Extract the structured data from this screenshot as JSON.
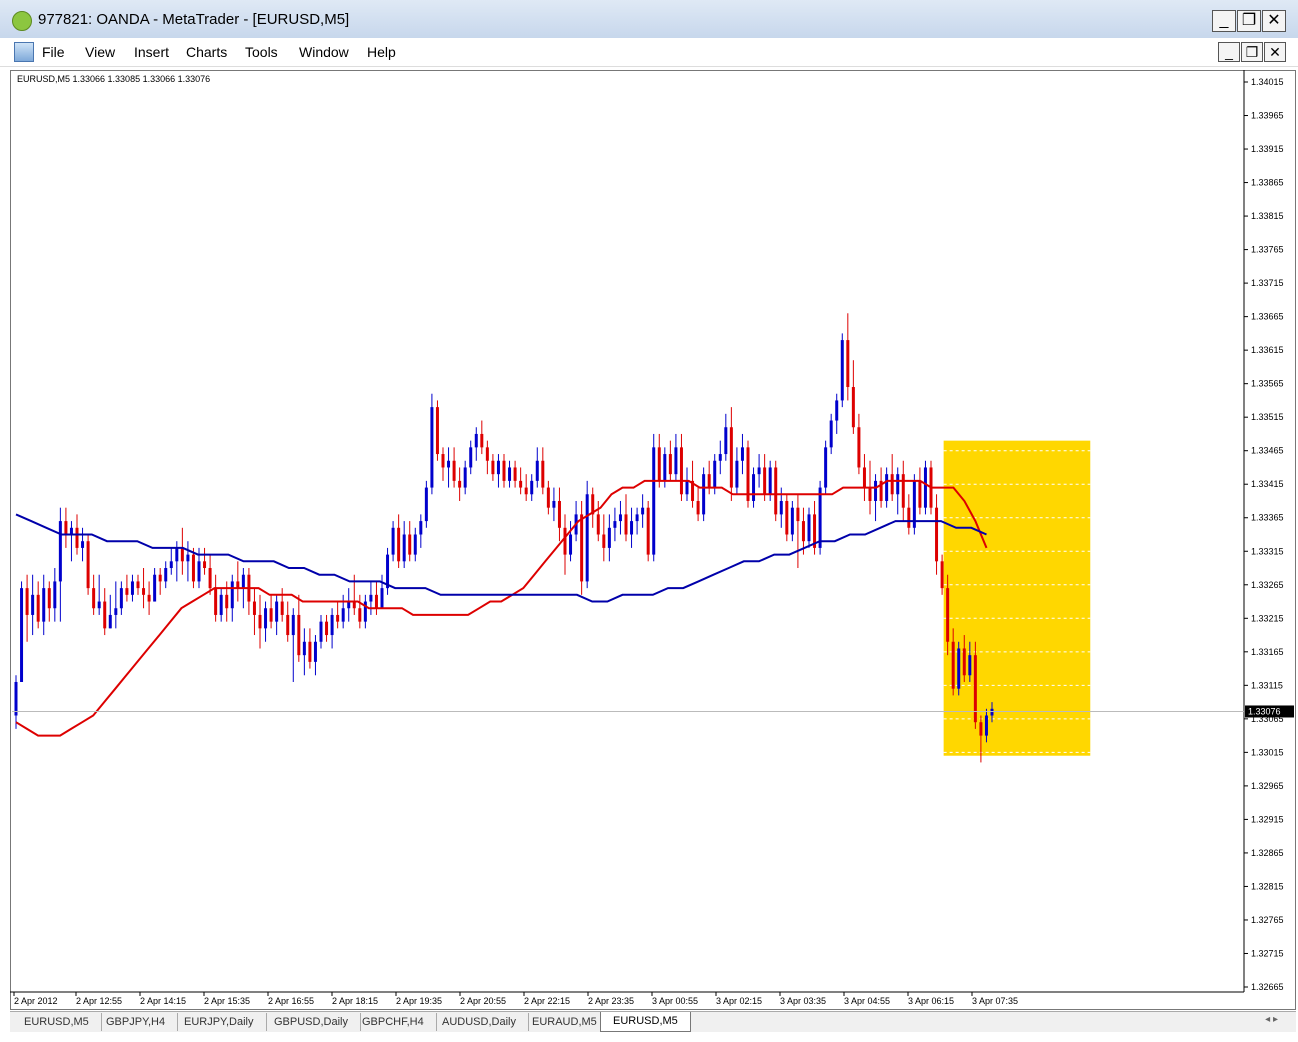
{
  "window": {
    "title": "977821: OANDA - MetaTrader - [EURUSD,M5]",
    "minimize": "_",
    "restore": "❐",
    "close": "✕"
  },
  "menu": {
    "items": [
      "File",
      "View",
      "Insert",
      "Charts",
      "Tools",
      "Window",
      "Help"
    ]
  },
  "chart": {
    "info": "EURUSD,M5  1.33066 1.33085 1.33066 1.33076",
    "current_price": "1.33076",
    "y_ticks": [
      "1.34015",
      "1.33965",
      "1.33915",
      "1.33865",
      "1.33815",
      "1.33765",
      "1.33715",
      "1.33665",
      "1.33615",
      "1.33565",
      "1.33515",
      "1.33465",
      "1.33415",
      "1.33365",
      "1.33315",
      "1.33265",
      "1.33215",
      "1.33165",
      "1.33115",
      "1.33065",
      "1.33015",
      "1.32965",
      "1.32915",
      "1.32865",
      "1.32815",
      "1.32765",
      "1.32715",
      "1.32665"
    ],
    "x_ticks": [
      "2 Apr 2012",
      "2 Apr 12:55",
      "2 Apr 14:15",
      "2 Apr 15:35",
      "2 Apr 16:55",
      "2 Apr 18:15",
      "2 Apr 19:35",
      "2 Apr 20:55",
      "2 Apr 22:15",
      "2 Apr 23:35",
      "3 Apr 00:55",
      "3 Apr 02:15",
      "3 Apr 03:35",
      "3 Apr 04:55",
      "3 Apr 06:15",
      "3 Apr 07:35"
    ],
    "colors": {
      "bull": "#0000cc",
      "bear": "#dd0000",
      "ma_fast": "#dd0000",
      "ma_slow": "#0000aa",
      "highlight": "#ffd700"
    }
  },
  "chart_data": {
    "type": "candlestick",
    "symbol": "EURUSD",
    "timeframe": "M5",
    "ylim": [
      1.32665,
      1.34015
    ],
    "highlight_range": {
      "start_index": 168,
      "end_index": 193,
      "low": 1.3301,
      "high": 1.3348
    },
    "candles": [
      [
        1.3307,
        1.3313,
        1.3305,
        1.3312
      ],
      [
        1.3312,
        1.3327,
        1.3312,
        1.3326
      ],
      [
        1.3326,
        1.3328,
        1.3318,
        1.3322
      ],
      [
        1.3322,
        1.3328,
        1.3319,
        1.3325
      ],
      [
        1.3325,
        1.3327,
        1.332,
        1.3321
      ],
      [
        1.3321,
        1.3328,
        1.3319,
        1.3326
      ],
      [
        1.3326,
        1.3327,
        1.3321,
        1.3323
      ],
      [
        1.3323,
        1.3329,
        1.3321,
        1.3327
      ],
      [
        1.3327,
        1.3338,
        1.3321,
        1.3336
      ],
      [
        1.3336,
        1.3338,
        1.3332,
        1.3334
      ],
      [
        1.3334,
        1.3336,
        1.333,
        1.3335
      ],
      [
        1.3335,
        1.3337,
        1.3331,
        1.3332
      ],
      [
        1.3332,
        1.3335,
        1.333,
        1.3333
      ],
      [
        1.3333,
        1.3334,
        1.3325,
        1.3326
      ],
      [
        1.3326,
        1.3328,
        1.3322,
        1.3323
      ],
      [
        1.3323,
        1.3328,
        1.3322,
        1.3324
      ],
      [
        1.3324,
        1.3326,
        1.3319,
        1.332
      ],
      [
        1.332,
        1.3325,
        1.332,
        1.3322
      ],
      [
        1.3322,
        1.3327,
        1.332,
        1.3323
      ],
      [
        1.3323,
        1.3327,
        1.3322,
        1.3326
      ],
      [
        1.3326,
        1.3328,
        1.3324,
        1.3325
      ],
      [
        1.3325,
        1.3328,
        1.3324,
        1.3327
      ],
      [
        1.3327,
        1.3328,
        1.3325,
        1.3326
      ],
      [
        1.3326,
        1.3329,
        1.3323,
        1.3325
      ],
      [
        1.3325,
        1.3327,
        1.3322,
        1.3324
      ],
      [
        1.3324,
        1.3329,
        1.3324,
        1.3328
      ],
      [
        1.3328,
        1.3329,
        1.3325,
        1.3327
      ],
      [
        1.3327,
        1.333,
        1.3326,
        1.3329
      ],
      [
        1.3329,
        1.3332,
        1.3328,
        1.333
      ],
      [
        1.333,
        1.3333,
        1.3327,
        1.3332
      ],
      [
        1.3332,
        1.3335,
        1.3328,
        1.333
      ],
      [
        1.333,
        1.3333,
        1.3327,
        1.3331
      ],
      [
        1.3331,
        1.3332,
        1.3326,
        1.3327
      ],
      [
        1.3327,
        1.3332,
        1.3326,
        1.333
      ],
      [
        1.333,
        1.3332,
        1.3328,
        1.3329
      ],
      [
        1.3329,
        1.3331,
        1.3325,
        1.3326
      ],
      [
        1.3326,
        1.3328,
        1.3321,
        1.3322
      ],
      [
        1.3322,
        1.3326,
        1.3321,
        1.3325
      ],
      [
        1.3325,
        1.3327,
        1.3321,
        1.3323
      ],
      [
        1.3323,
        1.3328,
        1.3321,
        1.3327
      ],
      [
        1.3327,
        1.333,
        1.3324,
        1.3326
      ],
      [
        1.3326,
        1.3329,
        1.3323,
        1.3328
      ],
      [
        1.3328,
        1.3329,
        1.3322,
        1.3324
      ],
      [
        1.3324,
        1.3326,
        1.3319,
        1.3322
      ],
      [
        1.3322,
        1.3325,
        1.3317,
        1.332
      ],
      [
        1.332,
        1.3324,
        1.3318,
        1.3323
      ],
      [
        1.3323,
        1.3325,
        1.332,
        1.3321
      ],
      [
        1.3321,
        1.3325,
        1.3319,
        1.3324
      ],
      [
        1.3324,
        1.3326,
        1.3321,
        1.3322
      ],
      [
        1.3322,
        1.3324,
        1.3318,
        1.3319
      ],
      [
        1.3319,
        1.3323,
        1.3312,
        1.3322
      ],
      [
        1.3322,
        1.3325,
        1.3315,
        1.3316
      ],
      [
        1.3316,
        1.332,
        1.3313,
        1.3318
      ],
      [
        1.3318,
        1.332,
        1.3314,
        1.3315
      ],
      [
        1.3315,
        1.3319,
        1.3313,
        1.3318
      ],
      [
        1.3318,
        1.3322,
        1.3317,
        1.3321
      ],
      [
        1.3321,
        1.3322,
        1.3318,
        1.3319
      ],
      [
        1.3319,
        1.3323,
        1.3317,
        1.3322
      ],
      [
        1.3322,
        1.3324,
        1.332,
        1.3321
      ],
      [
        1.3321,
        1.3325,
        1.332,
        1.3323
      ],
      [
        1.3323,
        1.3326,
        1.3321,
        1.3324
      ],
      [
        1.3324,
        1.3328,
        1.3322,
        1.3323
      ],
      [
        1.3323,
        1.3325,
        1.332,
        1.3321
      ],
      [
        1.3321,
        1.3325,
        1.332,
        1.3324
      ],
      [
        1.3324,
        1.3327,
        1.3322,
        1.3325
      ],
      [
        1.3325,
        1.3327,
        1.3322,
        1.3323
      ],
      [
        1.3323,
        1.3328,
        1.3323,
        1.3326
      ],
      [
        1.3326,
        1.3332,
        1.3325,
        1.3331
      ],
      [
        1.3331,
        1.3336,
        1.333,
        1.3335
      ],
      [
        1.3335,
        1.3337,
        1.3329,
        1.333
      ],
      [
        1.333,
        1.3336,
        1.3329,
        1.3334
      ],
      [
        1.3334,
        1.3336,
        1.333,
        1.3331
      ],
      [
        1.3331,
        1.3335,
        1.333,
        1.3334
      ],
      [
        1.3334,
        1.3337,
        1.3332,
        1.3336
      ],
      [
        1.3336,
        1.3342,
        1.3335,
        1.3341
      ],
      [
        1.3341,
        1.3355,
        1.334,
        1.3353
      ],
      [
        1.3353,
        1.3354,
        1.3345,
        1.3346
      ],
      [
        1.3346,
        1.3347,
        1.3342,
        1.3344
      ],
      [
        1.3344,
        1.3347,
        1.3341,
        1.3345
      ],
      [
        1.3345,
        1.3347,
        1.3341,
        1.3342
      ],
      [
        1.3342,
        1.3344,
        1.3339,
        1.3341
      ],
      [
        1.3341,
        1.3345,
        1.334,
        1.3344
      ],
      [
        1.3344,
        1.3348,
        1.3343,
        1.3347
      ],
      [
        1.3347,
        1.335,
        1.3345,
        1.3349
      ],
      [
        1.3349,
        1.3351,
        1.3346,
        1.3347
      ],
      [
        1.3347,
        1.3348,
        1.3343,
        1.3345
      ],
      [
        1.3345,
        1.3346,
        1.3342,
        1.3343
      ],
      [
        1.3343,
        1.3346,
        1.3341,
        1.3345
      ],
      [
        1.3345,
        1.3346,
        1.3341,
        1.3342
      ],
      [
        1.3342,
        1.3345,
        1.3341,
        1.3344
      ],
      [
        1.3344,
        1.3345,
        1.3341,
        1.3342
      ],
      [
        1.3342,
        1.3344,
        1.334,
        1.3341
      ],
      [
        1.3341,
        1.3343,
        1.3339,
        1.334
      ],
      [
        1.334,
        1.3343,
        1.3339,
        1.3342
      ],
      [
        1.3342,
        1.3347,
        1.3341,
        1.3345
      ],
      [
        1.3345,
        1.3347,
        1.334,
        1.3341
      ],
      [
        1.3341,
        1.3342,
        1.3337,
        1.3338
      ],
      [
        1.3338,
        1.3341,
        1.3336,
        1.3339
      ],
      [
        1.3339,
        1.3341,
        1.3333,
        1.3335
      ],
      [
        1.3335,
        1.3337,
        1.3328,
        1.3331
      ],
      [
        1.3331,
        1.3336,
        1.333,
        1.3334
      ],
      [
        1.3334,
        1.3339,
        1.3333,
        1.3337
      ],
      [
        1.3337,
        1.3339,
        1.3325,
        1.3327
      ],
      [
        1.3327,
        1.3342,
        1.3326,
        1.334
      ],
      [
        1.334,
        1.3341,
        1.3335,
        1.3337
      ],
      [
        1.3337,
        1.3339,
        1.3333,
        1.3334
      ],
      [
        1.3334,
        1.3337,
        1.333,
        1.3332
      ],
      [
        1.3332,
        1.3337,
        1.333,
        1.3335
      ],
      [
        1.3335,
        1.3338,
        1.3333,
        1.3336
      ],
      [
        1.3336,
        1.3339,
        1.3334,
        1.3337
      ],
      [
        1.3337,
        1.334,
        1.3333,
        1.3334
      ],
      [
        1.3334,
        1.3338,
        1.3332,
        1.3336
      ],
      [
        1.3336,
        1.3338,
        1.3334,
        1.3337
      ],
      [
        1.3337,
        1.334,
        1.3335,
        1.3338
      ],
      [
        1.3338,
        1.3339,
        1.333,
        1.3331
      ],
      [
        1.3331,
        1.3349,
        1.333,
        1.3347
      ],
      [
        1.3347,
        1.3349,
        1.3341,
        1.3342
      ],
      [
        1.3342,
        1.3347,
        1.3341,
        1.3346
      ],
      [
        1.3346,
        1.3348,
        1.3342,
        1.3343
      ],
      [
        1.3343,
        1.3349,
        1.3342,
        1.3347
      ],
      [
        1.3347,
        1.3349,
        1.3339,
        1.334
      ],
      [
        1.334,
        1.3344,
        1.3339,
        1.3342
      ],
      [
        1.3342,
        1.3345,
        1.3338,
        1.3339
      ],
      [
        1.3339,
        1.3341,
        1.3336,
        1.3337
      ],
      [
        1.3337,
        1.3344,
        1.3336,
        1.3343
      ],
      [
        1.3343,
        1.3345,
        1.334,
        1.3341
      ],
      [
        1.3341,
        1.3346,
        1.334,
        1.3345
      ],
      [
        1.3345,
        1.3348,
        1.3343,
        1.3346
      ],
      [
        1.3346,
        1.3352,
        1.3345,
        1.335
      ],
      [
        1.335,
        1.3353,
        1.3339,
        1.3341
      ],
      [
        1.3341,
        1.3347,
        1.334,
        1.3345
      ],
      [
        1.3345,
        1.3349,
        1.3343,
        1.3347
      ],
      [
        1.3347,
        1.3348,
        1.3338,
        1.3339
      ],
      [
        1.3339,
        1.3344,
        1.3338,
        1.3343
      ],
      [
        1.3343,
        1.3346,
        1.3341,
        1.3344
      ],
      [
        1.3344,
        1.3346,
        1.3339,
        1.334
      ],
      [
        1.334,
        1.3345,
        1.3339,
        1.3344
      ],
      [
        1.3344,
        1.3345,
        1.3336,
        1.3337
      ],
      [
        1.3337,
        1.3341,
        1.3335,
        1.3339
      ],
      [
        1.3339,
        1.334,
        1.3333,
        1.3334
      ],
      [
        1.3334,
        1.3339,
        1.3333,
        1.3338
      ],
      [
        1.3338,
        1.334,
        1.3329,
        1.3336
      ],
      [
        1.3336,
        1.3338,
        1.3331,
        1.3333
      ],
      [
        1.3333,
        1.3338,
        1.3332,
        1.3337
      ],
      [
        1.3337,
        1.3339,
        1.3331,
        1.3332
      ],
      [
        1.3332,
        1.3342,
        1.3331,
        1.3341
      ],
      [
        1.3341,
        1.3348,
        1.334,
        1.3347
      ],
      [
        1.3347,
        1.3352,
        1.3346,
        1.3351
      ],
      [
        1.3351,
        1.3355,
        1.3349,
        1.3354
      ],
      [
        1.3354,
        1.3364,
        1.3353,
        1.3363
      ],
      [
        1.3363,
        1.3367,
        1.3354,
        1.3356
      ],
      [
        1.3356,
        1.336,
        1.3349,
        1.335
      ],
      [
        1.335,
        1.3352,
        1.3343,
        1.3344
      ],
      [
        1.3344,
        1.3346,
        1.3339,
        1.3341
      ],
      [
        1.3341,
        1.3345,
        1.3337,
        1.3339
      ],
      [
        1.3339,
        1.3343,
        1.3336,
        1.3342
      ],
      [
        1.3342,
        1.3344,
        1.3338,
        1.3339
      ],
      [
        1.3339,
        1.3344,
        1.3338,
        1.3343
      ],
      [
        1.3343,
        1.3346,
        1.3339,
        1.334
      ],
      [
        1.334,
        1.3344,
        1.3337,
        1.3343
      ],
      [
        1.3343,
        1.3345,
        1.3336,
        1.3338
      ],
      [
        1.3338,
        1.334,
        1.3334,
        1.3335
      ],
      [
        1.3335,
        1.3343,
        1.3334,
        1.3342
      ],
      [
        1.3342,
        1.3344,
        1.3337,
        1.3338
      ],
      [
        1.3338,
        1.3345,
        1.3337,
        1.3344
      ],
      [
        1.3344,
        1.3345,
        1.3337,
        1.3338
      ],
      [
        1.3338,
        1.334,
        1.3328,
        1.333
      ],
      [
        1.333,
        1.3331,
        1.3325,
        1.3326
      ],
      [
        1.3326,
        1.3328,
        1.3316,
        1.3318
      ],
      [
        1.3318,
        1.332,
        1.331,
        1.3311
      ],
      [
        1.3311,
        1.3318,
        1.331,
        1.3317
      ],
      [
        1.3317,
        1.3319,
        1.3312,
        1.3313
      ],
      [
        1.3313,
        1.3318,
        1.3312,
        1.3316
      ],
      [
        1.3316,
        1.3318,
        1.3305,
        1.3306
      ],
      [
        1.3306,
        1.3307,
        1.33,
        1.3304
      ],
      [
        1.3304,
        1.3308,
        1.3303,
        1.3307
      ],
      [
        1.3307,
        1.3309,
        1.3306,
        1.3308
      ]
    ],
    "ma_fast": [
      1.3306,
      1.3305,
      1.3304,
      1.3304,
      1.3304,
      1.3305,
      1.3306,
      1.3307,
      1.3309,
      1.3311,
      1.3313,
      1.3315,
      1.3317,
      1.3319,
      1.3321,
      1.3323,
      1.3324,
      1.3325,
      1.3326,
      1.3326,
      1.3326,
      1.3326,
      1.3326,
      1.3325,
      1.3325,
      1.3325,
      1.3324,
      1.3324,
      1.3324,
      1.3324,
      1.3324,
      1.3324,
      1.3323,
      1.3323,
      1.3323,
      1.3323,
      1.3322,
      1.3322,
      1.3322,
      1.3322,
      1.3322,
      1.3322,
      1.3323,
      1.3324,
      1.3324,
      1.3325,
      1.3326,
      1.3328,
      1.333,
      1.3332,
      1.3334,
      1.3336,
      1.3337,
      1.3338,
      1.334,
      1.3341,
      1.3341,
      1.3342,
      1.3342,
      1.3342,
      1.3342,
      1.3342,
      1.3341,
      1.3341,
      1.3341,
      1.334,
      1.334,
      1.334,
      1.334,
      1.334,
      1.334,
      1.334,
      1.334,
      1.334,
      1.334,
      1.3341,
      1.3341,
      1.3341,
      1.3341,
      1.3342,
      1.3342,
      1.3342,
      1.3342,
      1.3341,
      1.3341,
      1.3341,
      1.3339,
      1.3336,
      1.3332
    ],
    "ma_slow": [
      1.3337,
      1.3336,
      1.3335,
      1.3334,
      1.3334,
      1.3334,
      1.3333,
      1.3333,
      1.3333,
      1.3332,
      1.3332,
      1.3332,
      1.3331,
      1.3331,
      1.3331,
      1.333,
      1.333,
      1.333,
      1.3329,
      1.3329,
      1.3328,
      1.3328,
      1.3327,
      1.3327,
      1.3327,
      1.3326,
      1.3326,
      1.3326,
      1.3325,
      1.3325,
      1.3325,
      1.3325,
      1.3325,
      1.3325,
      1.3325,
      1.3325,
      1.3325,
      1.3325,
      1.3324,
      1.3324,
      1.3325,
      1.3325,
      1.3325,
      1.3326,
      1.3326,
      1.3327,
      1.3328,
      1.3329,
      1.333,
      1.333,
      1.3331,
      1.3331,
      1.3332,
      1.3333,
      1.3333,
      1.3334,
      1.3334,
      1.3335,
      1.3336,
      1.3336,
      1.3336,
      1.3336,
      1.3335,
      1.3335,
      1.3334
    ]
  },
  "tabs": [
    "EURUSD,M5",
    "GBPJPY,H4",
    "EURJPY,Daily",
    "GBPUSD,Daily",
    "GBPCHF,H4",
    "AUDUSD,Daily",
    "EURAUD,M5",
    "EURUSD,M5"
  ],
  "tab_nav": "◂ ▸"
}
